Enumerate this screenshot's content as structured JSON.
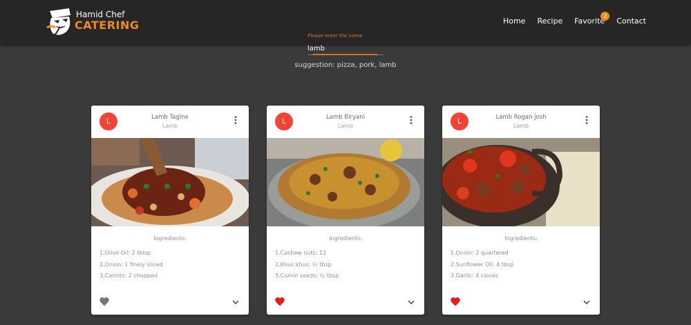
{
  "brand": {
    "name": "Hamid Chef",
    "subtitle": "CATERING",
    "accent_color": "#f08a1c"
  },
  "nav": {
    "items": [
      {
        "label": "Home"
      },
      {
        "label": "Recipe"
      },
      {
        "label": "Favorite",
        "badge": "2"
      },
      {
        "label": "Contact"
      }
    ]
  },
  "search": {
    "label": "Please enter the name",
    "value": "lamb",
    "suggestion": "suggestion: pizza, pork, lamb"
  },
  "cards": [
    {
      "avatar": "L",
      "title": "Lamb Tagine",
      "subtitle": "Lamb",
      "image_icon": "lamb-tagine-dish",
      "ingredients_title": "Ingredients:",
      "ingredients": [
        "1.Olive Oil: 2 tblsp",
        "2.Onion: 1 finely sliced",
        "3.Carrots: 2 chopped"
      ],
      "favorite": false
    },
    {
      "avatar": "L",
      "title": "Lamb Biryani",
      "subtitle": "Lamb",
      "image_icon": "lamb-biryani-dish",
      "ingredients_title": "Ingredients:",
      "ingredients": [
        "1.Cashew nuts: 12",
        "2.Khus khus: ½ tbsp",
        "3.Cumin seeds: ½ tbsp"
      ],
      "favorite": true
    },
    {
      "avatar": "L",
      "title": "Lamb Rogan josh",
      "subtitle": "Lamb",
      "image_icon": "lamb-rogan-josh-dish",
      "ingredients_title": "Ingredients:",
      "ingredients": [
        "1.Onion: 2 quartered",
        "2.Sunflower Oil: 4 tbsp",
        "3.Garlic: 4 cloves"
      ],
      "favorite": true
    }
  ]
}
